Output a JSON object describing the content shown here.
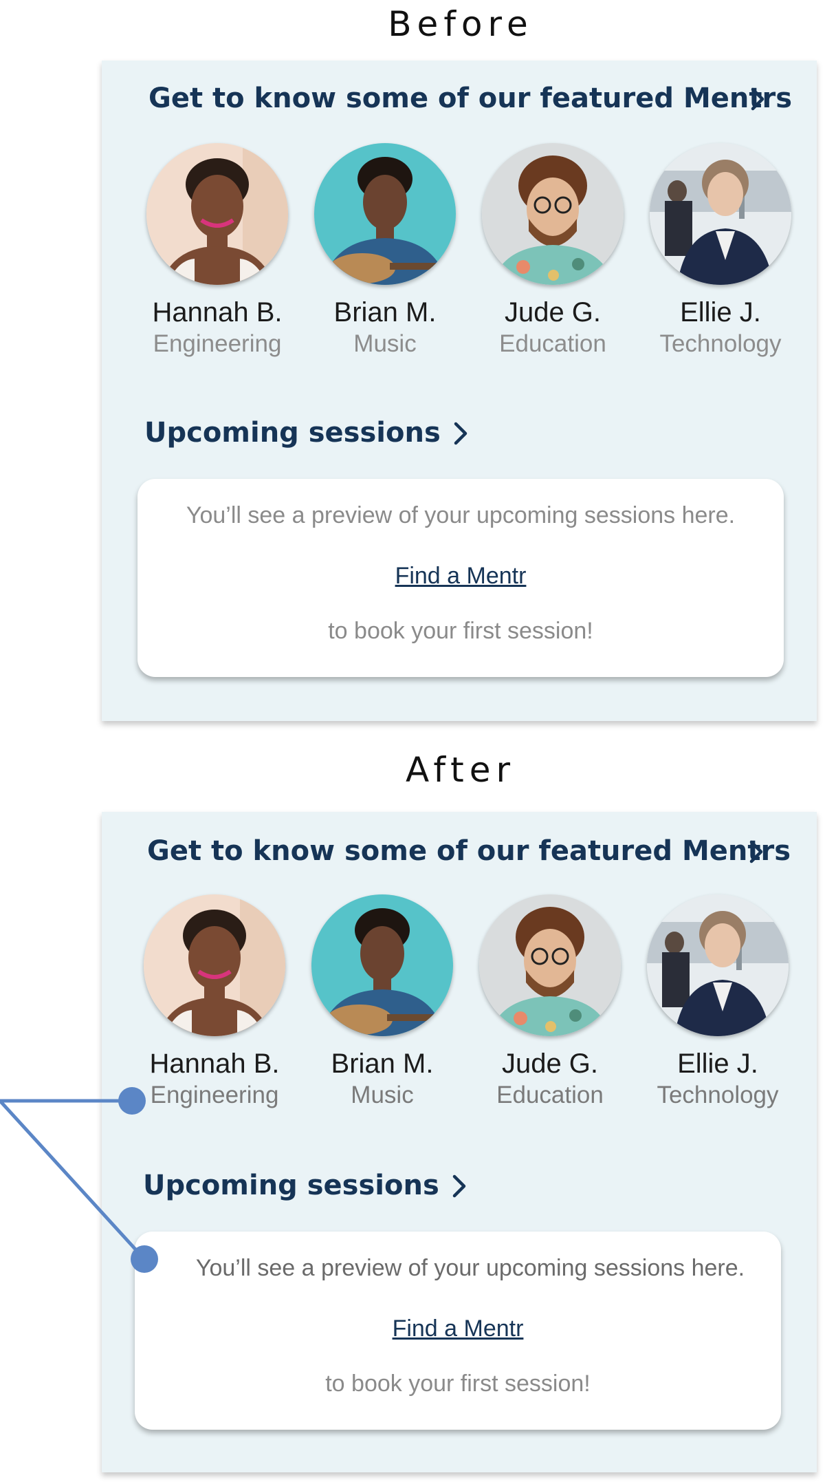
{
  "labels": {
    "before": "Before",
    "after": "After"
  },
  "featured": {
    "title": "Get to know some of our featured Mentrs",
    "chevron_icon": "chevron-right-icon",
    "mentors": [
      {
        "name": "Hannah B.",
        "field": "Engineering",
        "avatar_icon": "avatar-photo"
      },
      {
        "name": "Brian M.",
        "field": "Music",
        "avatar_icon": "avatar-photo"
      },
      {
        "name": "Jude G.",
        "field": "Education",
        "avatar_icon": "avatar-photo"
      },
      {
        "name": "Ellie J.",
        "field": "Technology",
        "avatar_icon": "avatar-photo"
      }
    ]
  },
  "upcoming": {
    "title": "Upcoming sessions",
    "chevron_icon": "chevron-right-icon",
    "hint": "You’ll see a preview of your upcoming sessions here.",
    "link": "Find a Mentr",
    "sub": "to book your first session!"
  },
  "colors": {
    "panel_bg": "#eaf3f6",
    "heading_navy": "#163456",
    "secondary_gray": "#8a8a8a",
    "annotation_blue": "#5b86c6"
  }
}
